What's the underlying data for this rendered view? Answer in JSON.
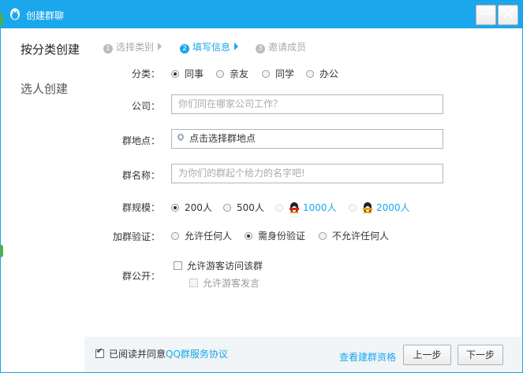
{
  "window": {
    "title": "创建群聊",
    "minimize_glyph": "—",
    "close_glyph": "✕"
  },
  "sidebar": {
    "items": [
      {
        "label": "按分类创建"
      },
      {
        "label": "选人创建"
      }
    ]
  },
  "steps": [
    {
      "num": "1",
      "label": "选择类别",
      "state": "inactive"
    },
    {
      "num": "2",
      "label": "填写信息",
      "state": "active"
    },
    {
      "num": "3",
      "label": "邀请成员",
      "state": "inactive"
    }
  ],
  "form": {
    "category": {
      "label": "分类：",
      "options": [
        "同事",
        "亲友",
        "同学",
        "办公"
      ],
      "selected": "同事"
    },
    "company": {
      "label": "公司：",
      "placeholder": "你们同在哪家公司工作？",
      "value": ""
    },
    "location": {
      "label": "群地点：",
      "value": "点击选择群地点"
    },
    "name": {
      "label": "群名称：",
      "placeholder": "为你们的群起个给力的名字吧!",
      "value": ""
    },
    "scale": {
      "label": "群规模：",
      "options": [
        "200人",
        "500人",
        "1000人",
        "2000人"
      ],
      "selected": "200人"
    },
    "verify": {
      "label": "加群验证：",
      "options": [
        "允许任何人",
        "需身份验证",
        "不允许任何人"
      ],
      "selected": "需身份验证"
    },
    "public": {
      "label": "群公开：",
      "allow_visitors": {
        "label": "允许游客访问该群",
        "checked": false
      },
      "allow_visitor_speak": {
        "label": "允许游客发言",
        "checked": false,
        "disabled": true
      }
    }
  },
  "footer": {
    "agree_prefix": "已阅读并同意",
    "agree_link": "QQ群服务协议",
    "agree_checked": true,
    "rules_link": "查看建群资格",
    "prev_button": "上一步",
    "next_button": "下一步"
  },
  "colors": {
    "accent": "#1aa7ec",
    "titlebar": "#1aa7ec",
    "footer_bg": "#f1f5f7"
  }
}
